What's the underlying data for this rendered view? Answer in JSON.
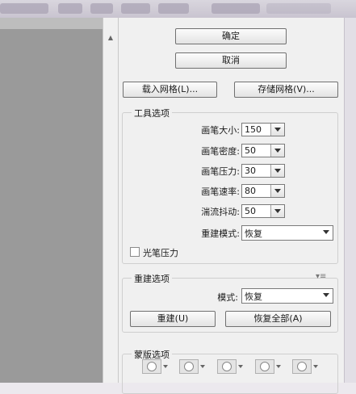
{
  "buttons": {
    "ok": "确定",
    "cancel": "取消",
    "load_mesh": "载入网格(L)...",
    "save_mesh": "存储网格(V)..."
  },
  "tool_options": {
    "title": "工具选项",
    "brush_size": {
      "label": "画笔大小:",
      "value": "150"
    },
    "brush_density": {
      "label": "画笔密度:",
      "value": "50"
    },
    "brush_pressure": {
      "label": "画笔压力:",
      "value": "30"
    },
    "brush_rate": {
      "label": "画笔速率:",
      "value": "80"
    },
    "turbulence": {
      "label": "湍流抖动:",
      "value": "50"
    },
    "reconstruct_mode": {
      "label": "重建模式:",
      "value": "恢复"
    },
    "stylus_pressure": "光笔压力"
  },
  "reconstruct_options": {
    "title": "重建选项",
    "mode": {
      "label": "模式:",
      "value": "恢复"
    },
    "reconstruct_button": "重建(U)",
    "restore_all_button": "恢复全部(A)"
  },
  "mask_options": {
    "title": "蒙版选项"
  },
  "colors": {
    "panel_bg": "#f0f0f0",
    "preview_bg": "#9a9a9a",
    "titlebar": "#cfcad6"
  },
  "icons": [
    "mask-replace-icon",
    "mask-add-icon",
    "mask-subtract-icon",
    "mask-intersect-icon",
    "mask-invert-icon",
    "panel-menu-icon",
    "scroll-up-icon",
    "dropdown-arrow-icon"
  ]
}
